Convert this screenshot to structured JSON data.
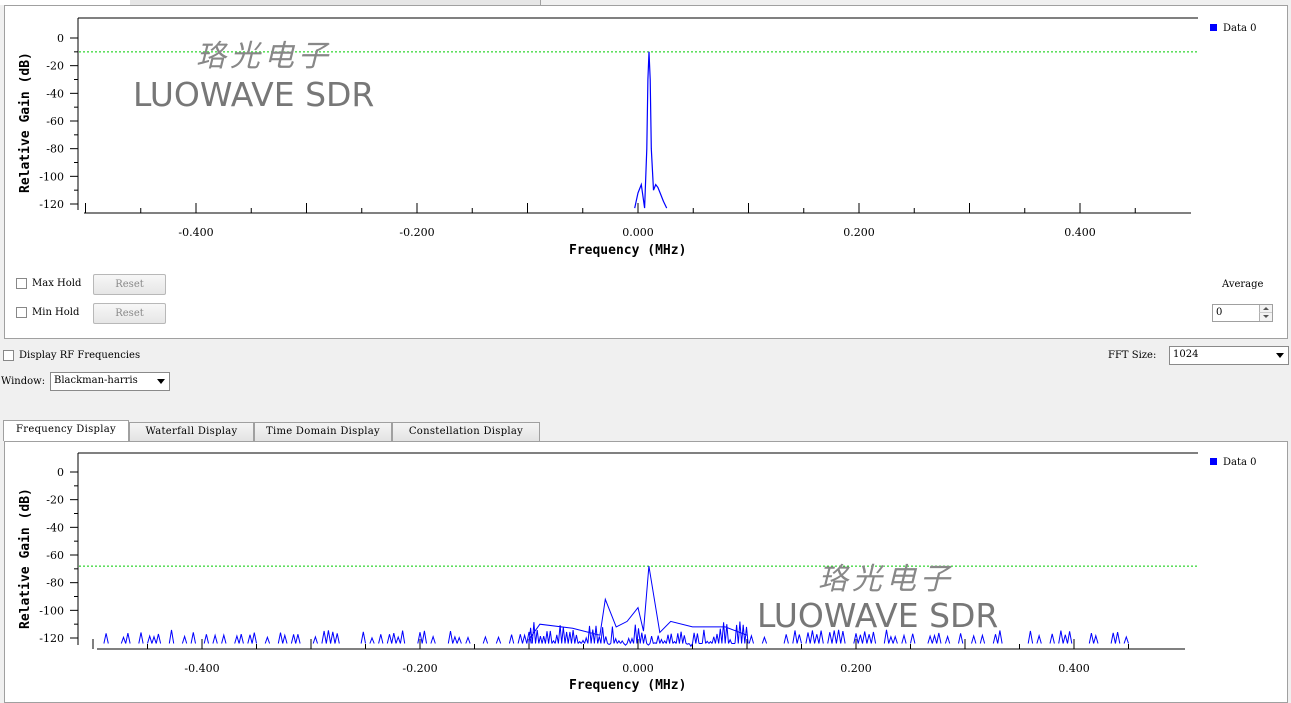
{
  "colors": {
    "trace": "#0000ff",
    "threshold": "#00cc00",
    "grid": "#000000"
  },
  "top_plot": {
    "ylabel": "Relative Gain (dB)",
    "xlabel": "Frequency (MHz)",
    "legend": "Data 0",
    "y_ticks": [
      "0",
      "-20",
      "-40",
      "-60",
      "-80",
      "-100",
      "-120"
    ],
    "x_ticks": [
      "-0.400",
      "-0.200",
      "0.000",
      "0.200",
      "0.400"
    ],
    "watermark_cn": "珞光电子",
    "watermark_en": "LUOWAVE SDR"
  },
  "controls": {
    "max_hold": "Max Hold",
    "min_hold": "Min Hold",
    "reset": "Reset",
    "average_label": "Average",
    "average_value": "0",
    "display_rf": "Display RF Frequencies",
    "fft_size_label": "FFT Size:",
    "fft_size_value": "1024",
    "window_label": "Window:",
    "window_value": "Blackman-harris"
  },
  "tabs": [
    "Frequency Display",
    "Waterfall Display",
    "Time Domain Display",
    "Constellation Display"
  ],
  "bottom_plot": {
    "ylabel": "Relative Gain (dB)",
    "xlabel": "Frequency (MHz)",
    "legend": "Data 0",
    "y_ticks": [
      "0",
      "-20",
      "-40",
      "-60",
      "-80",
      "-100",
      "-120"
    ],
    "x_ticks": [
      "-0.400",
      "-0.200",
      "0.000",
      "0.200",
      "0.400"
    ],
    "watermark_cn": "珞光电子",
    "watermark_en": "LUOWAVE SDR"
  },
  "chart_data": [
    {
      "type": "line",
      "xlabel": "Frequency (MHz)",
      "ylabel": "Relative Gain (dB)",
      "xlim": [
        -0.5,
        0.5
      ],
      "ylim": [
        -120,
        0
      ],
      "legend": [
        "Data 0"
      ],
      "threshold_db": -10,
      "series": [
        {
          "name": "Data 0",
          "x": [
            -0.003,
            0.0,
            0.003,
            0.006,
            0.008,
            0.009,
            0.01,
            0.011,
            0.012,
            0.014,
            0.016,
            0.018,
            0.02,
            0.023,
            0.026
          ],
          "y": [
            -123,
            -112,
            -106,
            -123,
            -80,
            -30,
            -10,
            -30,
            -80,
            -110,
            -106,
            -108,
            -112,
            -118,
            -123
          ]
        }
      ]
    },
    {
      "type": "line",
      "xlabel": "Frequency (MHz)",
      "ylabel": "Relative Gain (dB)",
      "xlim": [
        -0.5,
        0.5
      ],
      "ylim": [
        -120,
        0
      ],
      "legend": [
        "Data 0"
      ],
      "threshold_db": -68,
      "series": [
        {
          "name": "Data 0",
          "x": [
            -0.1,
            -0.09,
            -0.06,
            -0.035,
            -0.03,
            -0.02,
            -0.01,
            0.0,
            0.005,
            0.01,
            0.02,
            0.03,
            0.05,
            0.08,
            0.1
          ],
          "y": [
            -121,
            -110,
            -113,
            -118,
            -92,
            -112,
            -108,
            -98,
            -115,
            -68,
            -116,
            -108,
            -112,
            -112,
            -118
          ]
        }
      ]
    }
  ]
}
